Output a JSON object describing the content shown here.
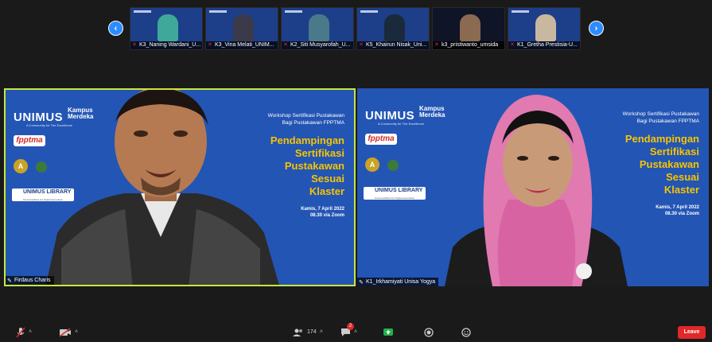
{
  "thumbnails": [
    {
      "label": "K3_Naning Wardani_U...",
      "type": "slide",
      "face_color": "#3fa89a"
    },
    {
      "label": "K3_Vina Melati_UNIM...",
      "type": "slide",
      "face_color": "#3a3a4a"
    },
    {
      "label": "K2_Siti Musyarofah_U...",
      "type": "slide",
      "face_color": "#4a7a8a"
    },
    {
      "label": "K5_Khairun Nisak_Uni...",
      "type": "slide",
      "face_color": "#1a2a3a"
    },
    {
      "label": "k3_pristiwanto_umsida",
      "type": "dark",
      "face_color": "#8a6a50"
    },
    {
      "label": "K1_Gretha Prestisia-U...",
      "type": "slide",
      "face_color": "#c9b8a0"
    }
  ],
  "slide": {
    "brand": "UNIMUS",
    "brand_sub": "A Community for The Excellence",
    "kampus": "Kampus Merdeka",
    "fpptma": "fpptma",
    "badge": "A",
    "library": "UNIMUS LIBRARY",
    "library_sub": "Great Facilities For Digital Generation",
    "ws_title_1": "Workshop Sertifikasi Pustakawan",
    "ws_title_2": "Bagi Pustakawan FPPTMA",
    "title_1": "Pendampingan",
    "title_2": "Sertifikasi",
    "title_3": "Pustakawan",
    "title_4": "Sesuai",
    "title_5": "Klaster",
    "date_1": "Kamis, 7 April 2022",
    "date_2": "08.30 via Zoom"
  },
  "main_left": {
    "name": "Firdaus Charis"
  },
  "main_right": {
    "name": "K1_Irkhamiyati Unisa Yogya"
  },
  "toolbar": {
    "participants_count": "174",
    "chat_badge": "2",
    "leave_label": "Leave"
  },
  "colors": {
    "accent": "#2d8cff",
    "slide_bg": "#2355b4",
    "title_yellow": "#f7c400",
    "leave_red": "#e02828",
    "active_border": "#c8e63c"
  }
}
